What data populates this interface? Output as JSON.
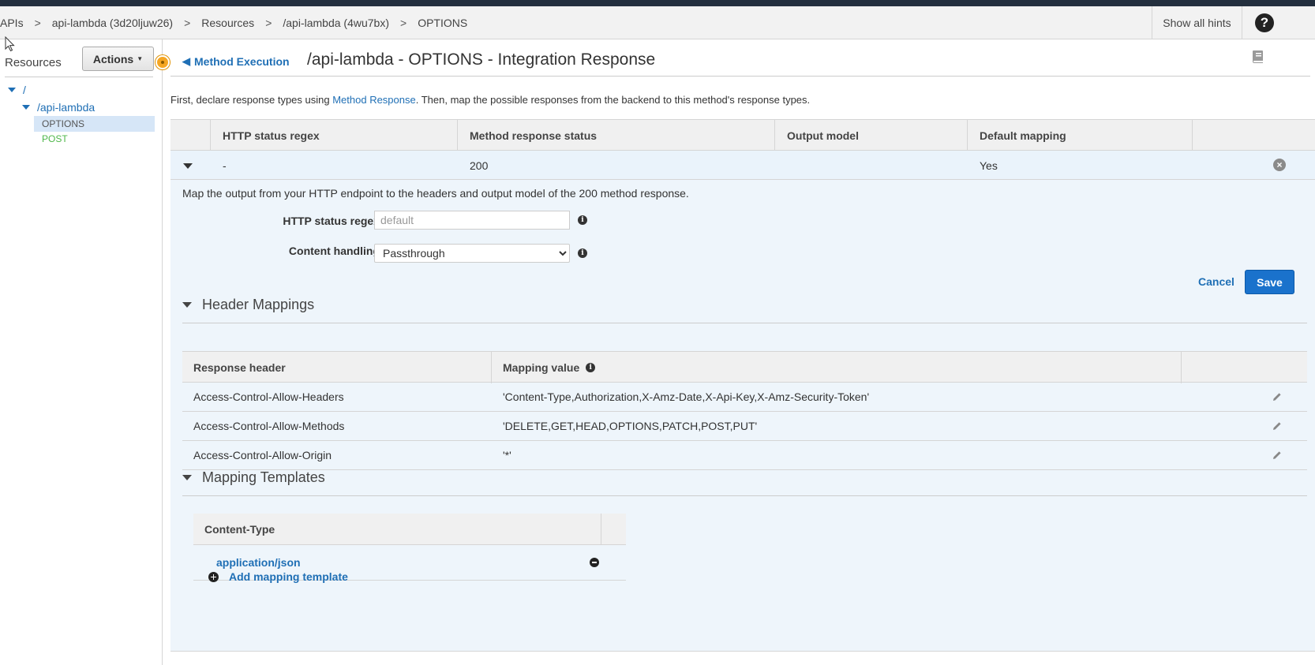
{
  "breadcrumb": {
    "items": [
      "APIs",
      "api-lambda (3d20ljuw26)",
      "Resources",
      "/api-lambda (4wu7bx)",
      "OPTIONS"
    ],
    "separator": ">"
  },
  "header": {
    "show_hints": "Show all hints",
    "help_icon": "?"
  },
  "sidebar": {
    "title": "Resources",
    "actions_label": "Actions",
    "tree": {
      "root": "/",
      "child": "/api-lambda",
      "methods": [
        "OPTIONS",
        "POST"
      ],
      "selected": "OPTIONS"
    }
  },
  "main": {
    "back_link": "Method Execution",
    "title": "/api-lambda - OPTIONS - Integration Response",
    "intro": {
      "before": "First, declare response types using ",
      "link": "Method Response",
      "after": ". Then, map the possible responses from the backend to this method's response types."
    },
    "response_table": {
      "columns": [
        "HTTP status regex",
        "Method response status",
        "Output model",
        "Default mapping"
      ],
      "rows": [
        {
          "regex": "-",
          "status": "200",
          "output_model": "",
          "default_mapping": "Yes"
        }
      ]
    },
    "detail": {
      "description": "Map the output from your HTTP endpoint to the headers and output model of the 200 method response.",
      "regex_label": "HTTP status regex",
      "regex_placeholder": "default",
      "regex_value": "",
      "content_handling_label": "Content handling",
      "content_handling_value": "Passthrough",
      "cancel": "Cancel",
      "save": "Save"
    },
    "header_mappings": {
      "title": "Header Mappings",
      "columns": [
        "Response header",
        "Mapping value"
      ],
      "rows": [
        {
          "header": "Access-Control-Allow-Headers",
          "value": "'Content-Type,Authorization,X-Amz-Date,X-Api-Key,X-Amz-Security-Token'"
        },
        {
          "header": "Access-Control-Allow-Methods",
          "value": "'DELETE,GET,HEAD,OPTIONS,PATCH,POST,PUT'"
        },
        {
          "header": "Access-Control-Allow-Origin",
          "value": "'*'"
        }
      ]
    },
    "mapping_templates": {
      "title": "Mapping Templates",
      "column": "Content-Type",
      "rows": [
        "application/json"
      ],
      "add_label": "Add mapping template"
    }
  },
  "colors": {
    "accent": "#1f6fb5",
    "save_button": "#1a72cc",
    "selected_row": "#d6e6f7",
    "detail_bg": "#eef5fb",
    "post_method": "#4fb74a",
    "handle": "#f5a623"
  }
}
